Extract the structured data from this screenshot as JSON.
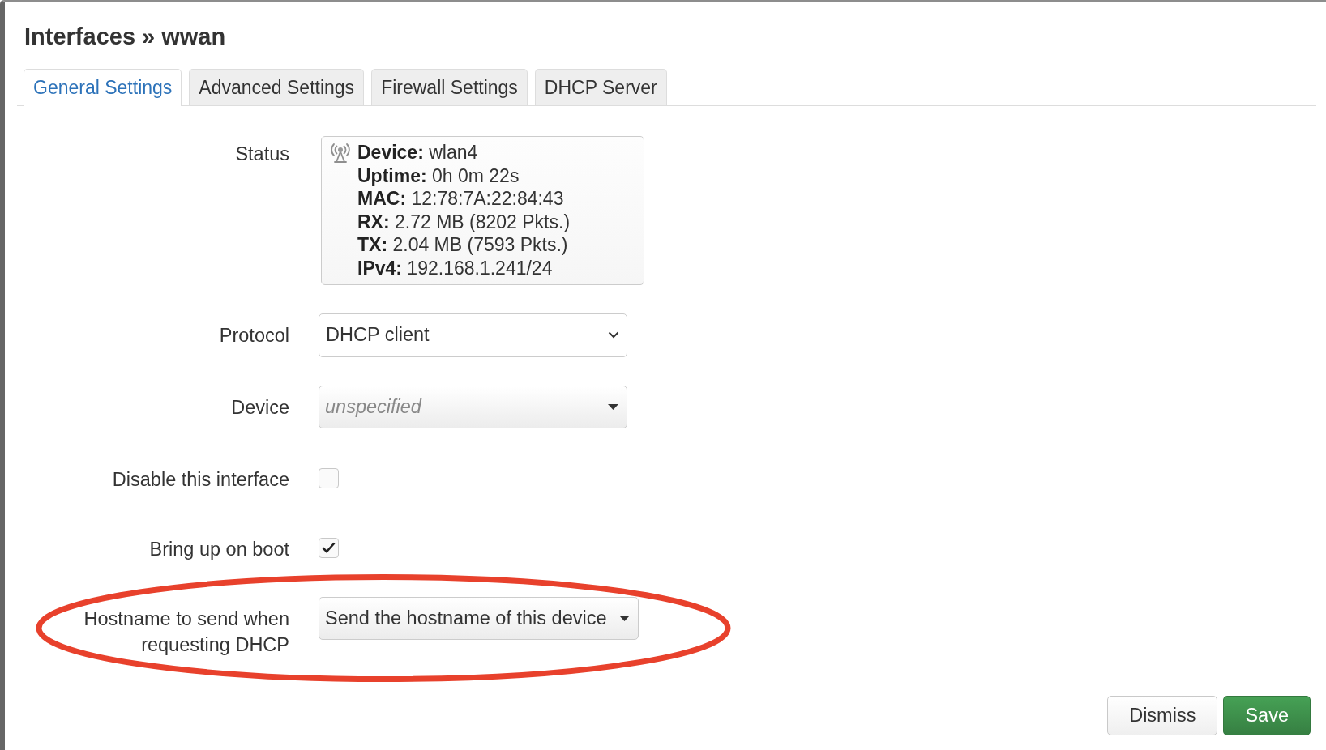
{
  "title": "Interfaces » wwan",
  "tabs": [
    {
      "label": "General Settings",
      "selected": true
    },
    {
      "label": "Advanced Settings",
      "selected": false
    },
    {
      "label": "Firewall Settings",
      "selected": false
    },
    {
      "label": "DHCP Server",
      "selected": false
    }
  ],
  "fields": [
    {
      "kind": "status",
      "label": "Status",
      "highlighted": false,
      "lines": [
        "**Device:** wlan4",
        "**Uptime:** 0h 0m 22s",
        "**MAC:** 12:78:7A:22:84:43",
        "**RX:** 2.72 MB (8202 Pkts.)",
        "**TX:** 2.04 MB (7593 Pkts.)",
        "**IPv4:** 192.168.1.241/24"
      ]
    },
    {
      "kind": "select",
      "label": "Protocol",
      "value": "DHCP client",
      "highlighted": false
    },
    {
      "kind": "dropdown",
      "label": "Device",
      "placeholder": "unspecified",
      "highlighted": false
    },
    {
      "kind": "checkbox",
      "label": "Disable this interface",
      "checked": false,
      "highlighted": false
    },
    {
      "kind": "checkbox",
      "label": "Bring up on boot",
      "checked": true,
      "highlighted": false
    },
    {
      "kind": "dropdown",
      "label": "Hostname to send when requesting DHCP",
      "value": "Send the hostname of this device",
      "highlighted": true
    }
  ],
  "buttons": [
    {
      "label": "Dismiss",
      "kind": "default"
    },
    {
      "label": "Save",
      "kind": "primary"
    }
  ]
}
